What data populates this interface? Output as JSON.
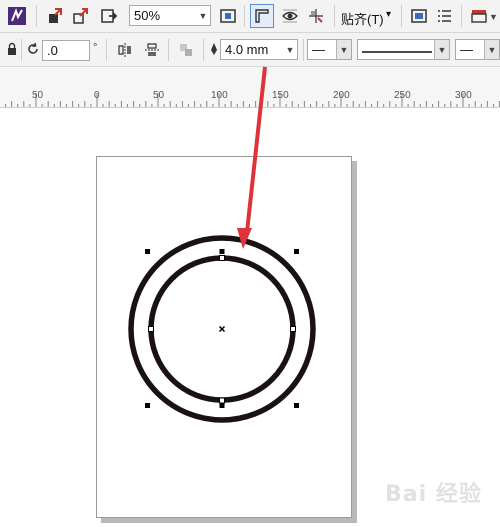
{
  "toolbar_top": {
    "zoom": "50%",
    "snap_menu": "贴齐(T)",
    "snap_menu_arrow": "▾"
  },
  "toolbar_props": {
    "rotation_value": ".0",
    "rotation_unit": "°",
    "outline_width": "4.0 mm",
    "line_start_style": "—",
    "line_end_style": "—"
  },
  "ruler": {
    "labels": [
      "50",
      "0",
      "50",
      "100",
      "150",
      "200",
      "250",
      "300"
    ]
  },
  "watermark": "Bai 经验",
  "colors": {
    "annotation_arrow": "#e0323a",
    "circle_stroke": "#1a1210",
    "toolbar_bg": "#f3f3f3",
    "active_button_border": "#5c8fd4"
  }
}
